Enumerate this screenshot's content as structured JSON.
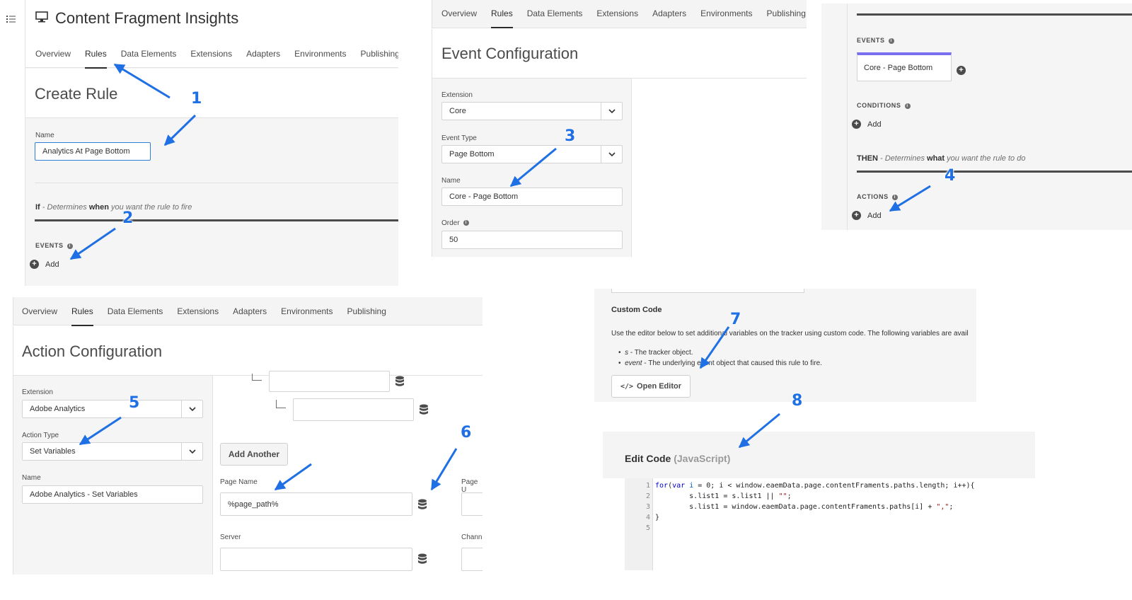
{
  "panel1": {
    "app_title": "Content Fragment Insights",
    "tabs": [
      "Overview",
      "Rules",
      "Data Elements",
      "Extensions",
      "Adapters",
      "Environments",
      "Publishing"
    ],
    "heading": "Create Rule",
    "name_label": "Name",
    "name_value": "Analytics At Page Bottom",
    "if_label": "If",
    "if_note_pre": " - Determines ",
    "if_note_bold": "when",
    "if_note_post": " you want the rule to fire",
    "events_label": "EVENTS",
    "add_label": "Add"
  },
  "panel2": {
    "tabs": [
      "Overview",
      "Rules",
      "Data Elements",
      "Extensions",
      "Adapters",
      "Environments",
      "Publishing"
    ],
    "heading": "Event Configuration",
    "extension_label": "Extension",
    "extension_value": "Core",
    "event_type_label": "Event Type",
    "event_type_value": "Page Bottom",
    "name_label": "Name",
    "name_value": "Core - Page Bottom",
    "order_label": "Order",
    "order_value": "50"
  },
  "panel3": {
    "events_label": "EVENTS",
    "event_card": "Core - Page Bottom",
    "conditions_label": "CONDITIONS",
    "add_label": "Add",
    "then_label": "THEN",
    "then_note_pre": " - Determines ",
    "then_note_bold": "what",
    "then_note_post": " you want the rule to do",
    "actions_label": "ACTIONS",
    "add_label2": "Add"
  },
  "panel4": {
    "tabs": [
      "Overview",
      "Rules",
      "Data Elements",
      "Extensions",
      "Adapters",
      "Environments",
      "Publishing"
    ],
    "heading": "Action Configuration",
    "extension_label": "Extension",
    "extension_value": "Adobe Analytics",
    "action_type_label": "Action Type",
    "action_type_value": "Set Variables",
    "name_label": "Name",
    "name_value": "Adobe Analytics - Set Variables",
    "add_another": "Add Another",
    "page_name_label": "Page Name",
    "page_name_value": "%page_path%",
    "server_label": "Server",
    "page_u_label": "Page U",
    "chann_label": "Chann"
  },
  "panel5": {
    "title": "Custom Code",
    "description": "Use the editor below to set additional variables on the tracker using custom code. The following variables are avail",
    "bullet1_key": "s",
    "bullet1_text": " - The tracker object.",
    "bullet2_key": "event",
    "bullet2_text": " - The underlying event object that caused this rule to fire.",
    "open_editor": "Open Editor"
  },
  "panel6": {
    "title": "Edit Code",
    "lang": "(JavaScript)",
    "line_numbers": [
      "1",
      "2",
      "3",
      "4",
      "5"
    ]
  },
  "callouts": [
    "1",
    "2",
    "3",
    "4",
    "5",
    "6",
    "7",
    "8"
  ],
  "colors": {
    "arrow": "#1f6fe5",
    "accent_bar": "#7a6ff0",
    "text": "#323232"
  },
  "icons": [
    "monitor-icon",
    "menu-icon",
    "chevron-down-icon",
    "info-icon",
    "plus-circle-icon",
    "database-icon",
    "code-icon",
    "arrow-icon"
  ]
}
